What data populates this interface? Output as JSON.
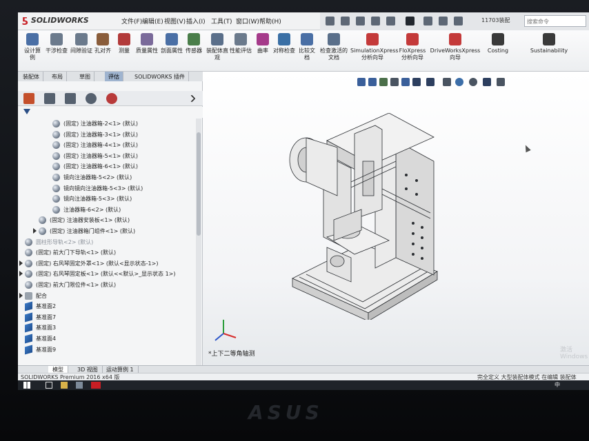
{
  "app": {
    "logo_text": "SOLIDWORKS",
    "doc_name": "11703装配"
  },
  "menus": [
    "文件(F)",
    "编辑(E)",
    "视图(V)",
    "插入(I)",
    "工具(T)",
    "窗口(W)",
    "帮助(H)"
  ],
  "search_placeholder": "搜索命令",
  "tools": [
    {
      "label": "设计算例",
      "icon": "design-study-icon"
    },
    {
      "label": "干涉检查",
      "icon": "interference-icon"
    },
    {
      "label": "间隙验证",
      "icon": "clearance-icon"
    },
    {
      "label": "孔对齐",
      "icon": "hole-align-icon"
    },
    {
      "label": "测量",
      "icon": "measure-icon"
    },
    {
      "label": "质量属性",
      "icon": "mass-properties-icon"
    },
    {
      "label": "剖面属性",
      "icon": "section-properties-icon"
    },
    {
      "label": "传感器",
      "icon": "sensor-icon"
    },
    {
      "label": "装配体直观",
      "icon": "assembly-visualization-icon"
    },
    {
      "label": "性能评估",
      "icon": "performance-icon"
    },
    {
      "label": "曲率",
      "icon": "curvature-icon"
    },
    {
      "label": "对称检查",
      "icon": "symmetry-check-icon"
    },
    {
      "label": "比较文档",
      "icon": "compare-documents-icon"
    },
    {
      "label": "检查激活的文档",
      "icon": "check-active-doc-icon"
    },
    {
      "label": "SimulationXpress 分析向导",
      "icon": "simulationxpress-icon"
    },
    {
      "label": "FloXpress 分析向导",
      "icon": "floxpress-icon"
    },
    {
      "label": "DriveWorksXpress 向导",
      "icon": "driveworksxpress-icon"
    },
    {
      "label": "Costing",
      "icon": "costing-icon"
    },
    {
      "label": "Sustainability",
      "icon": "sustainability-icon"
    }
  ],
  "cmd_tabs": [
    {
      "label": "装配体",
      "active": false
    },
    {
      "label": "布局",
      "active": false
    },
    {
      "label": "草图",
      "active": false
    },
    {
      "label": "评估",
      "active": true
    },
    {
      "label": "SOLIDWORKS 插件",
      "active": false
    }
  ],
  "tree": [
    {
      "text": "(固定) 注油器箱-2<1> (默认)",
      "indent": 2,
      "icon": "part"
    },
    {
      "text": "(固定) 注油器箱-3<1> (默认)",
      "indent": 2,
      "icon": "part"
    },
    {
      "text": "(固定) 注油器箱-4<1> (默认)",
      "indent": 2,
      "icon": "part"
    },
    {
      "text": "(固定) 注油器箱-5<1> (默认)",
      "indent": 2,
      "icon": "part"
    },
    {
      "text": "(固定) 注油器箱-6<1> (默认)",
      "indent": 2,
      "icon": "part"
    },
    {
      "text": "镜向注油器箱-5<2> (默认)",
      "indent": 2,
      "icon": "part"
    },
    {
      "text": "镜向镜向注油器箱-5<3> (默认)",
      "indent": 2,
      "icon": "part"
    },
    {
      "text": "镜向注油器箱-5<3> (默认)",
      "indent": 2,
      "icon": "part"
    },
    {
      "text": "注油器箱-6<2> (默认)",
      "indent": 2,
      "icon": "part"
    },
    {
      "text": "(固定) 注油器安装板<1> (默认)",
      "indent": 1,
      "icon": "part"
    },
    {
      "text": "(固定) 注油器箱门组件<1> (默认)",
      "indent": 1,
      "icon": "assembly",
      "expandable": true
    },
    {
      "text": "圆柱形导轨<2> (默认)",
      "indent": 0,
      "icon": "part",
      "faded": true
    },
    {
      "text": "(固定) 前大门下导轨<1> (默认)",
      "indent": 0,
      "icon": "part"
    },
    {
      "text": "(固定) 右风琴固定外罩<1> (默认<显示状态-1>)",
      "indent": 0,
      "icon": "part",
      "expandable": true
    },
    {
      "text": "(固定) 右风琴固定板<1> (默认<<默认>_显示状态 1>)",
      "indent": 0,
      "icon": "part",
      "expandable": true
    },
    {
      "text": "(固定) 前大门限位件<1> (默认)",
      "indent": 0,
      "icon": "part"
    },
    {
      "text": "配合",
      "indent": 0,
      "icon": "mates",
      "expandable": true
    },
    {
      "text": "基准面2",
      "indent": 0,
      "icon": "plane"
    },
    {
      "text": "基准面7",
      "indent": 0,
      "icon": "plane"
    },
    {
      "text": "基准面3",
      "indent": 0,
      "icon": "plane"
    },
    {
      "text": "基准面4",
      "indent": 0,
      "icon": "plane"
    },
    {
      "text": "基准面9",
      "indent": 0,
      "icon": "plane"
    }
  ],
  "view_label": "*上下二等角轴测",
  "watermark": "激活 Windows",
  "bottom_tabs": [
    {
      "label": "模型",
      "active": true
    },
    {
      "label": "3D 视图",
      "active": false
    },
    {
      "label": "运动算例 1",
      "active": false
    }
  ],
  "status": {
    "left": "SOLIDWORKS Premium 2016 x64 版",
    "right": "完全定义   大型装配体模式   在编辑 装配体"
  },
  "tray_text": "中",
  "colors": {
    "accent": "#9fb4cf",
    "brand": "#c81e24"
  }
}
